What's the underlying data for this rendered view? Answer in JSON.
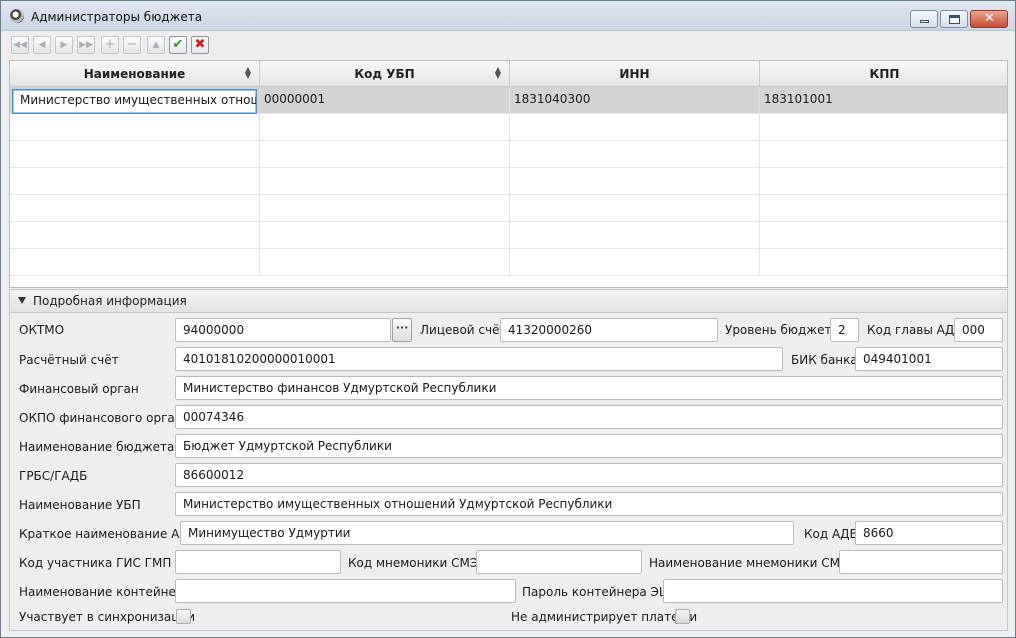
{
  "window": {
    "title": "Администраторы бюджета"
  },
  "toolbar": {
    "first": "◀◀",
    "prev": "◀",
    "next": "▶",
    "last": "▶▶",
    "add": "+",
    "remove": "−",
    "up": "▲",
    "ok": "✔",
    "cancel": "✖"
  },
  "table": {
    "columns": [
      "Наименование",
      "Код УБП",
      "ИНН",
      "КПП"
    ],
    "rows": [
      [
        "Министерство имущественных отношени",
        "00000001",
        "1831040300",
        "183101001"
      ]
    ]
  },
  "details": {
    "title": "Подробная информация",
    "oktmo_label": "ОКТМО",
    "oktmo": "94000000",
    "dots": "···",
    "account_label": "Лицевой счёт",
    "account": "41320000260",
    "level_label": "Уровень бюджета",
    "level": "2",
    "head_code_label": "Код главы АДБ",
    "head_code": "000",
    "settlement_label": "Расчётный счёт",
    "settlement": "40101810200000010001",
    "bik_label": "БИК банка",
    "bik": "049401001",
    "fin_org_label": "Финансовый орган",
    "fin_org": "Министерство финансов Удмуртской Республики",
    "okpo_label": "ОКПО финансового органа",
    "okpo": "00074346",
    "budget_name_label": "Наименование бюджета",
    "budget_name": "Бюджет Удмуртской Республики",
    "grbs_label": "ГРБС/ГАДБ",
    "grbs": "86600012",
    "ubp_name_label": "Наименование УБП",
    "ubp_name": "Министерство имущественных отношений Удмуртской Республики",
    "short_name_label": "Краткое наименование АДБ",
    "short_name": "Минимущество Удмуртии",
    "adb_code_label": "Код АДБ",
    "adb_code": "8660",
    "gis_label": "Код участника ГИС ГМП",
    "gis": "",
    "smev_code_label": "Код мнемоники СМЭВ",
    "smev_code": "",
    "smev_name_label": "Наименование мнемоники СМЭВ",
    "smev_name": "",
    "container_label": "Наименование контейнера",
    "container": "",
    "password_label": "Пароль контейнера ЭЦП",
    "password": "",
    "sync_label": "Участвует в синхронизации",
    "no_payments_label": "Не администрирует платежи"
  }
}
